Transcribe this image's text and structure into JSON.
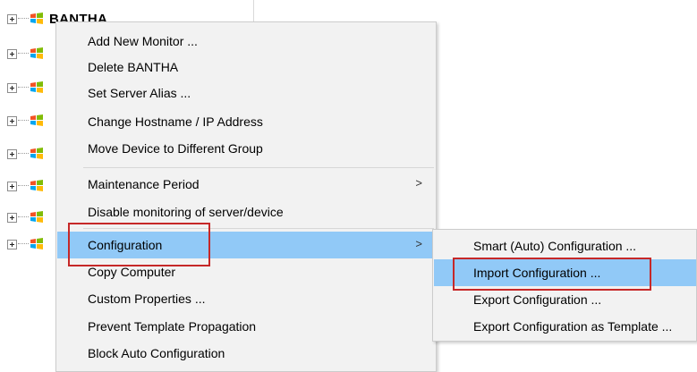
{
  "tree": {
    "root_label": "BANTHA",
    "node_count": 8
  },
  "context_menu": {
    "items": [
      {
        "label": "Add New Monitor ..."
      },
      {
        "label": "Delete BANTHA"
      },
      {
        "label": "Set Server Alias ..."
      },
      {
        "label": "Change Hostname / IP Address"
      },
      {
        "label": "Move Device to Different Group"
      },
      {
        "label": "Maintenance Period",
        "submenu_arrow": ">"
      },
      {
        "label": "Disable monitoring of server/device"
      },
      {
        "label": "Configuration",
        "submenu_arrow": ">",
        "highlighted": true
      },
      {
        "label": "Copy Computer"
      },
      {
        "label": "Custom Properties ..."
      },
      {
        "label": "Prevent Template Propagation"
      },
      {
        "label": "Block Auto Configuration"
      }
    ]
  },
  "configuration_submenu": {
    "items": [
      {
        "label": "Smart (Auto) Configuration ..."
      },
      {
        "label": "Import Configuration ...",
        "highlighted": true
      },
      {
        "label": "Export Configuration ..."
      },
      {
        "label": "Export Configuration as Template ..."
      }
    ]
  },
  "colors": {
    "highlight": "#91c9f7",
    "menu_background": "#f2f2f2",
    "annotation_box": "#c62828"
  }
}
